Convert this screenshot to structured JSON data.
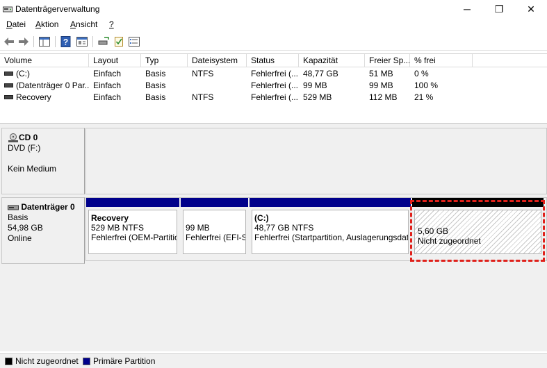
{
  "window": {
    "title": "Datenträgerverwaltung",
    "minimize_glyph": "─",
    "maximize_glyph": "❐",
    "close_glyph": "✕"
  },
  "menu": {
    "items": [
      {
        "accel": "D",
        "rest": "atei"
      },
      {
        "accel": "A",
        "rest": "ktion"
      },
      {
        "accel": "A",
        "rest": "nsicht"
      },
      {
        "accel": "?",
        "rest": ""
      }
    ]
  },
  "toolbar": {
    "icons": [
      "back-icon",
      "forward-icon",
      "show-hide-tree-icon",
      "help-icon",
      "properties-icon",
      "connect-disk-icon",
      "check-icon",
      "view-list-icon"
    ]
  },
  "volumes": {
    "columns": [
      "Volume",
      "Layout",
      "Typ",
      "Dateisystem",
      "Status",
      "Kapazität",
      "Freier Sp...",
      "% frei"
    ],
    "rows": [
      [
        "(C:)",
        "Einfach",
        "Basis",
        "NTFS",
        "Fehlerfrei (...",
        "48,77 GB",
        "51 MB",
        "0 %"
      ],
      [
        "(Datenträger 0 Par...",
        "Einfach",
        "Basis",
        "",
        "Fehlerfrei (...",
        "99 MB",
        "99 MB",
        "100 %"
      ],
      [
        "Recovery",
        "Einfach",
        "Basis",
        "NTFS",
        "Fehlerfrei (...",
        "529 MB",
        "112 MB",
        "21 %"
      ]
    ]
  },
  "cd0": {
    "name": "CD 0",
    "type": "DVD (F:)",
    "media": "Kein Medium"
  },
  "disk0": {
    "name": "Datenträger 0",
    "type": "Basis",
    "size": "54,98 GB",
    "state": "Online",
    "partitions": [
      {
        "title": "Recovery",
        "size": "529 MB NTFS",
        "status": "Fehlerfrei (OEM-Partitio"
      },
      {
        "title": "",
        "size": "99 MB",
        "status": "Fehlerfrei (EFI-Sy"
      },
      {
        "title": "(C:)",
        "size": "48,77 GB NTFS",
        "status": "Fehlerfrei (Startpartition, Auslagerungsdatei"
      }
    ],
    "unallocated": {
      "size": "5,60 GB",
      "label": "Nicht zugeordnet"
    }
  },
  "legend": {
    "items": [
      {
        "label": "Nicht zugeordnet",
        "color": "#000000"
      },
      {
        "label": "Primäre Partition",
        "color": "#00008b"
      }
    ]
  },
  "colors": {
    "primary_partition": "#00008b",
    "unallocated": "#000000",
    "highlight": "#e0201a"
  }
}
